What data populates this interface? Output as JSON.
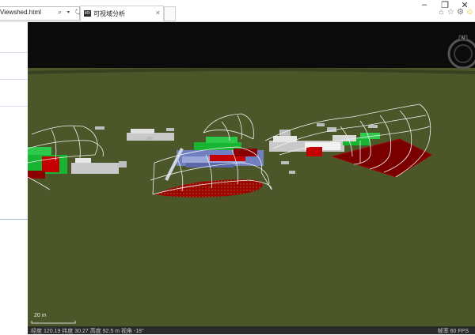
{
  "browser": {
    "address_text": "Viewshed.html",
    "address_icons": "⌕ ▾ ↻",
    "tab_title": "可视域分析",
    "tab_favicon": "MX",
    "tab_close": "×",
    "window_controls": {
      "minimize": "–",
      "restore": "❐",
      "close": "✕"
    },
    "toolbar_icons": [
      "home-icon",
      "star-icon",
      "settings-icon",
      "smiley-icon"
    ]
  },
  "viewer": {
    "scale_label": "20 m",
    "status_left": "经度 120.19 纬度 30.27   高度 92.5 m   视角 -18°",
    "status_right": "帧率 60 FPS",
    "colors": {
      "sky": "#0b0b0b",
      "ground": "#4b5729",
      "visible": "#17b531",
      "invisible": "#a30000",
      "shade": "#6d0000"
    }
  }
}
